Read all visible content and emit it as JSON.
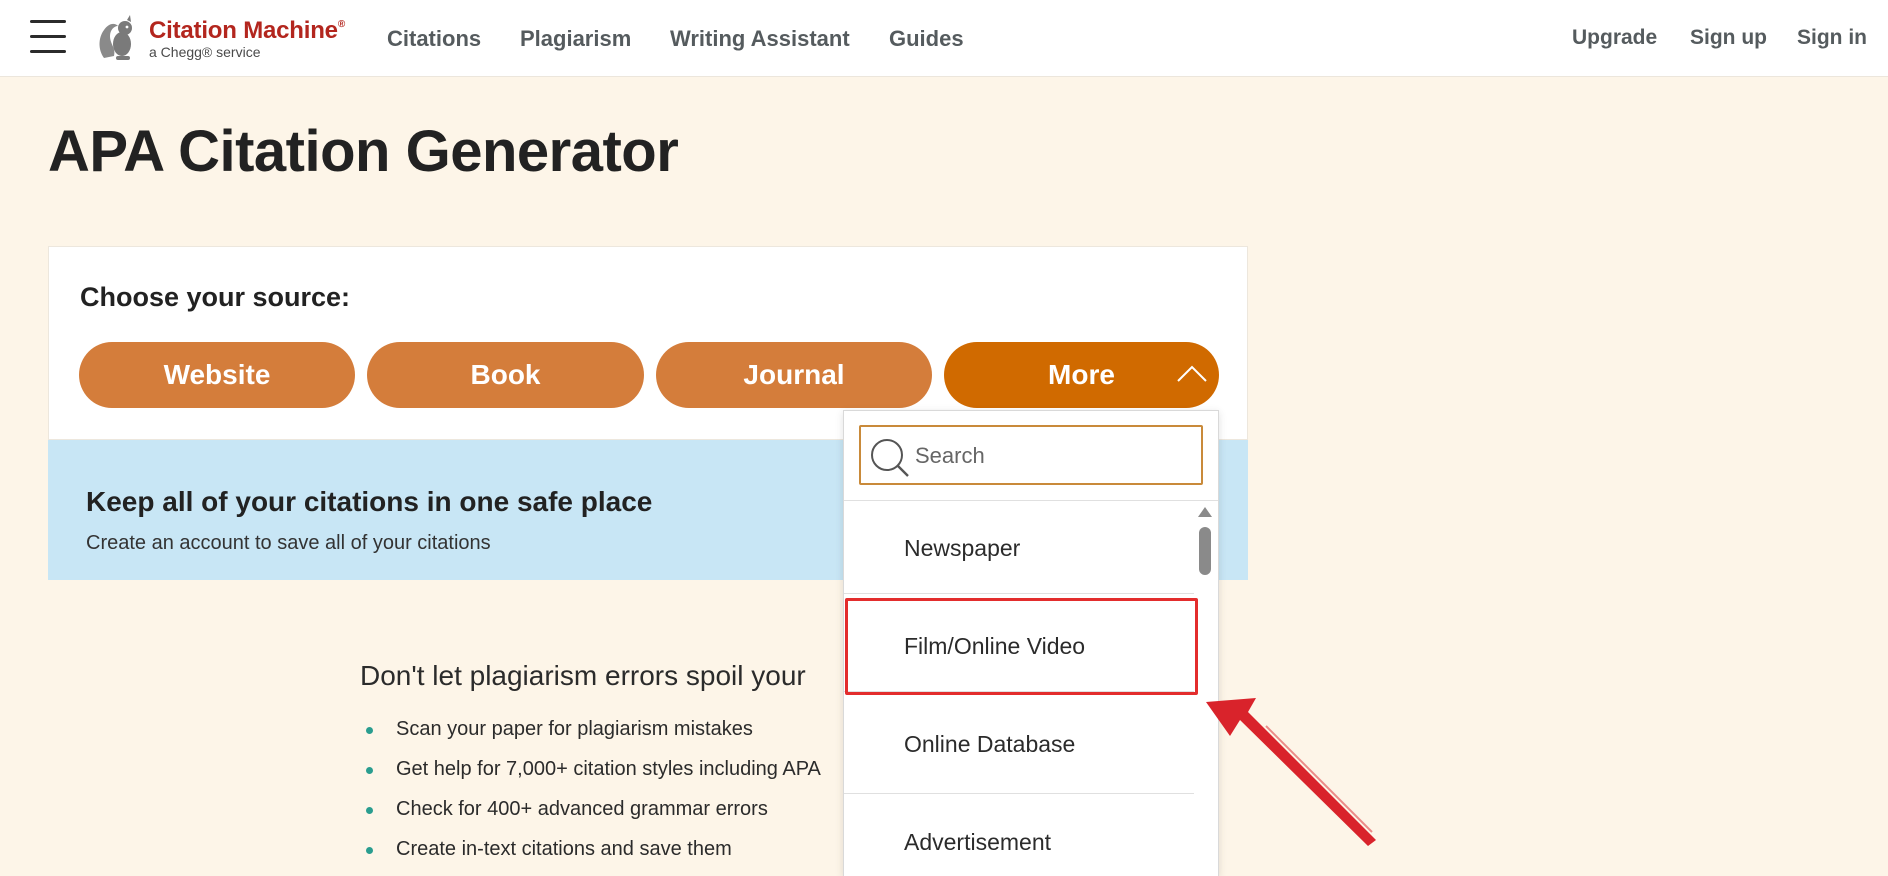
{
  "header": {
    "logo": {
      "name": "Citation Machine",
      "registered": "®",
      "sub": "a Chegg® service"
    },
    "nav": [
      "Citations",
      "Plagiarism",
      "Writing Assistant",
      "Guides"
    ],
    "right": [
      "Upgrade",
      "Sign up",
      "Sign in"
    ]
  },
  "page_title": "APA Citation Generator",
  "source_card": {
    "label": "Choose your source:",
    "buttons": [
      "Website",
      "Book",
      "Journal",
      "More"
    ]
  },
  "banner": {
    "title": "Keep all of your citations in one safe place",
    "subtitle": "Create an account to save all of your citations"
  },
  "promo": {
    "title": "Don't let plagiarism errors spoil your",
    "items": [
      "Scan your paper for plagiarism mistakes",
      "Get help for 7,000+ citation styles including APA",
      "Check for 400+ advanced grammar errors",
      "Create in-text citations and save them"
    ]
  },
  "dropdown": {
    "search_placeholder": "Search",
    "items": [
      "Newspaper",
      "Film/Online Video",
      "Online Database",
      "Advertisement"
    ]
  },
  "colors": {
    "brand_red": "#b3261e",
    "button_orange": "#d47d3b",
    "more_orange": "#d06a00",
    "banner_blue": "#c8e6f5",
    "page_bg": "#fdf5e8",
    "annotation_red": "#e32d2d"
  }
}
